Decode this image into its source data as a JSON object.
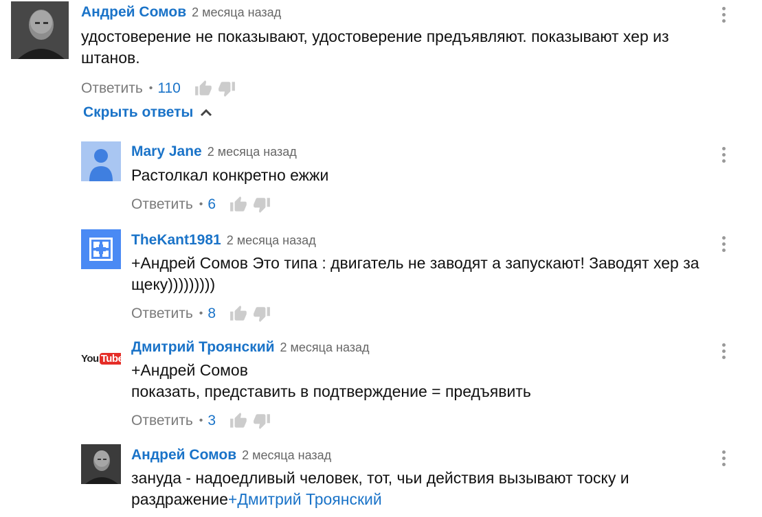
{
  "comments": [
    {
      "author": "Андрей Сомов",
      "time": "2 месяца назад",
      "text_lines": [
        "удостоверение не показывают, удостоверение предъявляют. показывают хер из",
        "штанов."
      ],
      "reply_label": "Ответить",
      "likes": "110",
      "avatar": "photo-man-avatar"
    },
    {
      "author": "Mary Jane",
      "time": "2 месяца назад",
      "text_lines": [
        "Растолкал конкретно ежжи"
      ],
      "reply_label": "Ответить",
      "likes": "6",
      "avatar": "default-user-avatar"
    },
    {
      "author": "TheKant1981",
      "time": "2 месяца назад",
      "text_lines": [
        "+Андрей Сомов Это типа : двигатель не заводят а запускают! Заводят хер за",
        "щеку)))))))))"
      ],
      "reply_label": "Ответить",
      "likes": "8",
      "avatar": "google-plus-avatar"
    },
    {
      "author": "Дмитрий Троянский",
      "time": "2 месяца назад",
      "text_lines": [
        "+Андрей Сомов",
        "показать, представить в подтверждение = предъявить"
      ],
      "reply_label": "Ответить",
      "likes": "3",
      "avatar": "youtube-logo-avatar",
      "avatar_text_you": "You",
      "avatar_text_tube": "Tube"
    },
    {
      "author": "Андрей Сомов",
      "time": "2 месяца назад",
      "text_lines": [
        "зануда - надоедливый человек, тот, чьи действия вызывают тоску и",
        "раздражение"
      ],
      "mention": "+Дмитрий Троянский",
      "avatar": "photo-man-avatar"
    }
  ],
  "toggle": {
    "label": "Скрыть ответы",
    "icon": "chevron-up-icon"
  },
  "separator": "•",
  "colors": {
    "link": "#1a73c8",
    "muted": "#7a7a7a",
    "icon": "#cccccc"
  }
}
